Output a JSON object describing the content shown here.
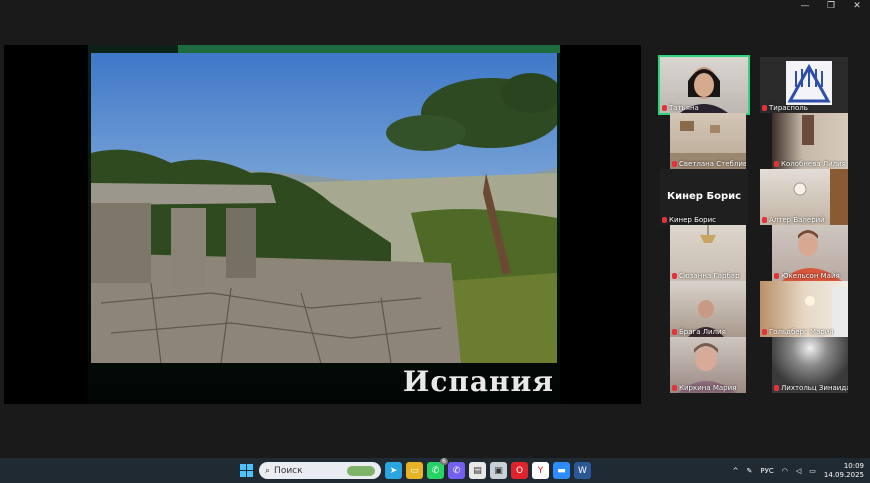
{
  "window": {
    "controls": [
      "—",
      "❐",
      "✕"
    ]
  },
  "slide": {
    "caption": "Испания"
  },
  "participants": [
    {
      "name": "Татьяна",
      "active": true
    },
    {
      "name": "Тирасполь"
    },
    {
      "name": "Светлана Стебливец"
    },
    {
      "name": "Колобнева Лилия"
    },
    {
      "name": "Кинер Борис",
      "display_name": "Кинер Борис"
    },
    {
      "name": "Алтер Валерий"
    },
    {
      "name": "Сюзанна Гарбар"
    },
    {
      "name": "Юкельсон Майя"
    },
    {
      "name": "Брага Лилия"
    },
    {
      "name": "Гольдберг Мария"
    },
    {
      "name": "Киркина Мария"
    },
    {
      "name": "Лихтольц Зинаида"
    }
  ],
  "taskbar": {
    "search_label": "Поиск",
    "language": "РУС",
    "time": "10:09",
    "date": "14.09.2025",
    "whatsapp_badge": "6"
  },
  "colors": {
    "active_speaker": "#2ed47a",
    "slide_green": "#1e6b3d",
    "mic_muted": "#e2333a",
    "taskbar": "#202a33"
  }
}
